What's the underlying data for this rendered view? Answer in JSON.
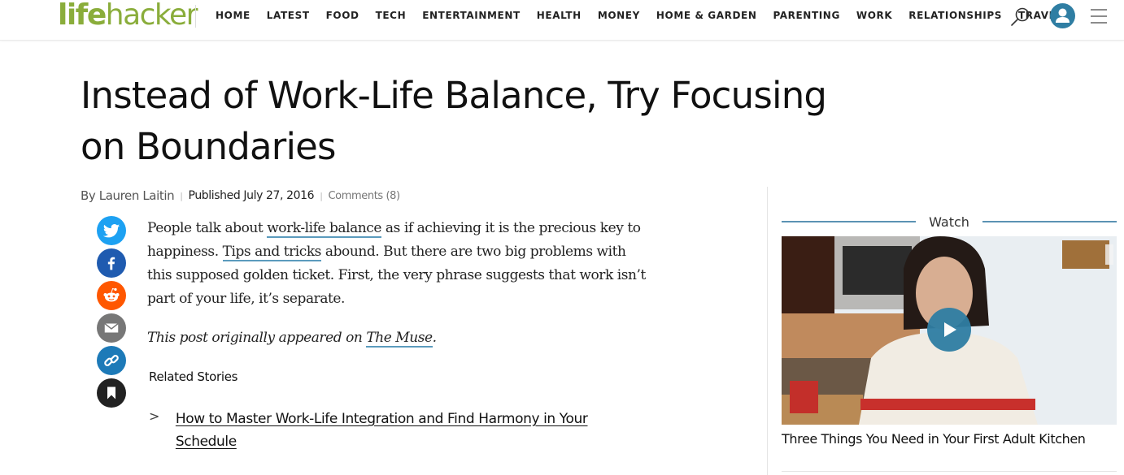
{
  "header": {
    "logo": {
      "bold": "life",
      "thin": "hacker"
    },
    "nav": [
      "HOME",
      "LATEST",
      "FOOD",
      "TECH",
      "ENTERTAINMENT",
      "HEALTH",
      "MONEY",
      "HOME & GARDEN",
      "PARENTING",
      "WORK",
      "RELATIONSHIPS",
      "TRAVEL"
    ],
    "icons": {
      "search": "search-icon",
      "user": "user-icon",
      "menu": "hamburger-menu-icon"
    }
  },
  "article": {
    "title": "Instead of Work-Life Balance, Try Focusing on Boundaries",
    "byline": {
      "author": "By Lauren Laitin",
      "published_label": "Published",
      "date": "July 27, 2016",
      "comments": "Comments (8)"
    },
    "paragraph1": {
      "t1": "People talk about ",
      "link1": "work-life balance",
      "t2": " as if achieving it is the precious key to happiness. ",
      "link2": "Tips and tricks",
      "t3": " abound. But there are two big problems with this supposed golden ticket. First, the very phrase suggests that work isn’t part of your life, it’s separate."
    },
    "paragraph2": {
      "t1": "This post originally appeared on ",
      "link": "The Muse",
      "t2": "."
    },
    "related": {
      "title": "Related Stories",
      "items": [
        {
          "label": "How to Master Work-Life Integration and Find Harmony in Your Schedule"
        }
      ]
    },
    "share": [
      "twitter",
      "facebook",
      "reddit",
      "email",
      "copy-link",
      "bookmark"
    ]
  },
  "colors": {
    "brand": "#8aad3b",
    "accent": "#5b92b3",
    "twitter": "#1da1f2",
    "facebook": "#1f5bb0",
    "reddit": "#ff5700",
    "email": "#777777",
    "link": "#1d7ab8",
    "bookmark": "#222222",
    "user": "#2f7ea3"
  },
  "sidebar": {
    "section_label": "Watch",
    "video_title": "Three Things You Need in Your First Adult Kitchen"
  }
}
